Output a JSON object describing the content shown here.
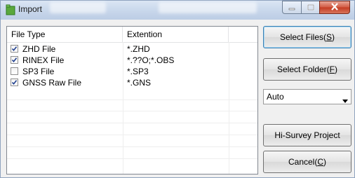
{
  "window": {
    "title": "Import",
    "controls": {
      "minimize_icon": "minimize-icon",
      "maximize_icon": "maximize-icon",
      "close_icon": "close-icon"
    }
  },
  "file_list": {
    "columns": [
      "File Type",
      "Extention"
    ],
    "rows": [
      {
        "name": "ZHD File",
        "extension": "*.ZHD",
        "checked": true
      },
      {
        "name": "RINEX File",
        "extension": "*.??O;*.OBS",
        "checked": true
      },
      {
        "name": "SP3 File",
        "extension": "*.SP3",
        "checked": false
      },
      {
        "name": "GNSS Raw File",
        "extension": "*.GNS",
        "checked": true
      }
    ]
  },
  "buttons": {
    "select_files": {
      "text": "Select Files(",
      "key": "S",
      "end": ")"
    },
    "select_folder": {
      "text": "Select Folder(",
      "key": "F",
      "end": ")"
    },
    "hi_survey": {
      "text": "Hi-Survey Project"
    },
    "cancel": {
      "text": "Cancel(",
      "key": "C",
      "end": ")"
    }
  },
  "mode_select": {
    "value": "Auto"
  },
  "colors": {
    "accent": "#3c7fb1",
    "check": "#1f3f8f",
    "title_bar": "#c6d5ea"
  }
}
